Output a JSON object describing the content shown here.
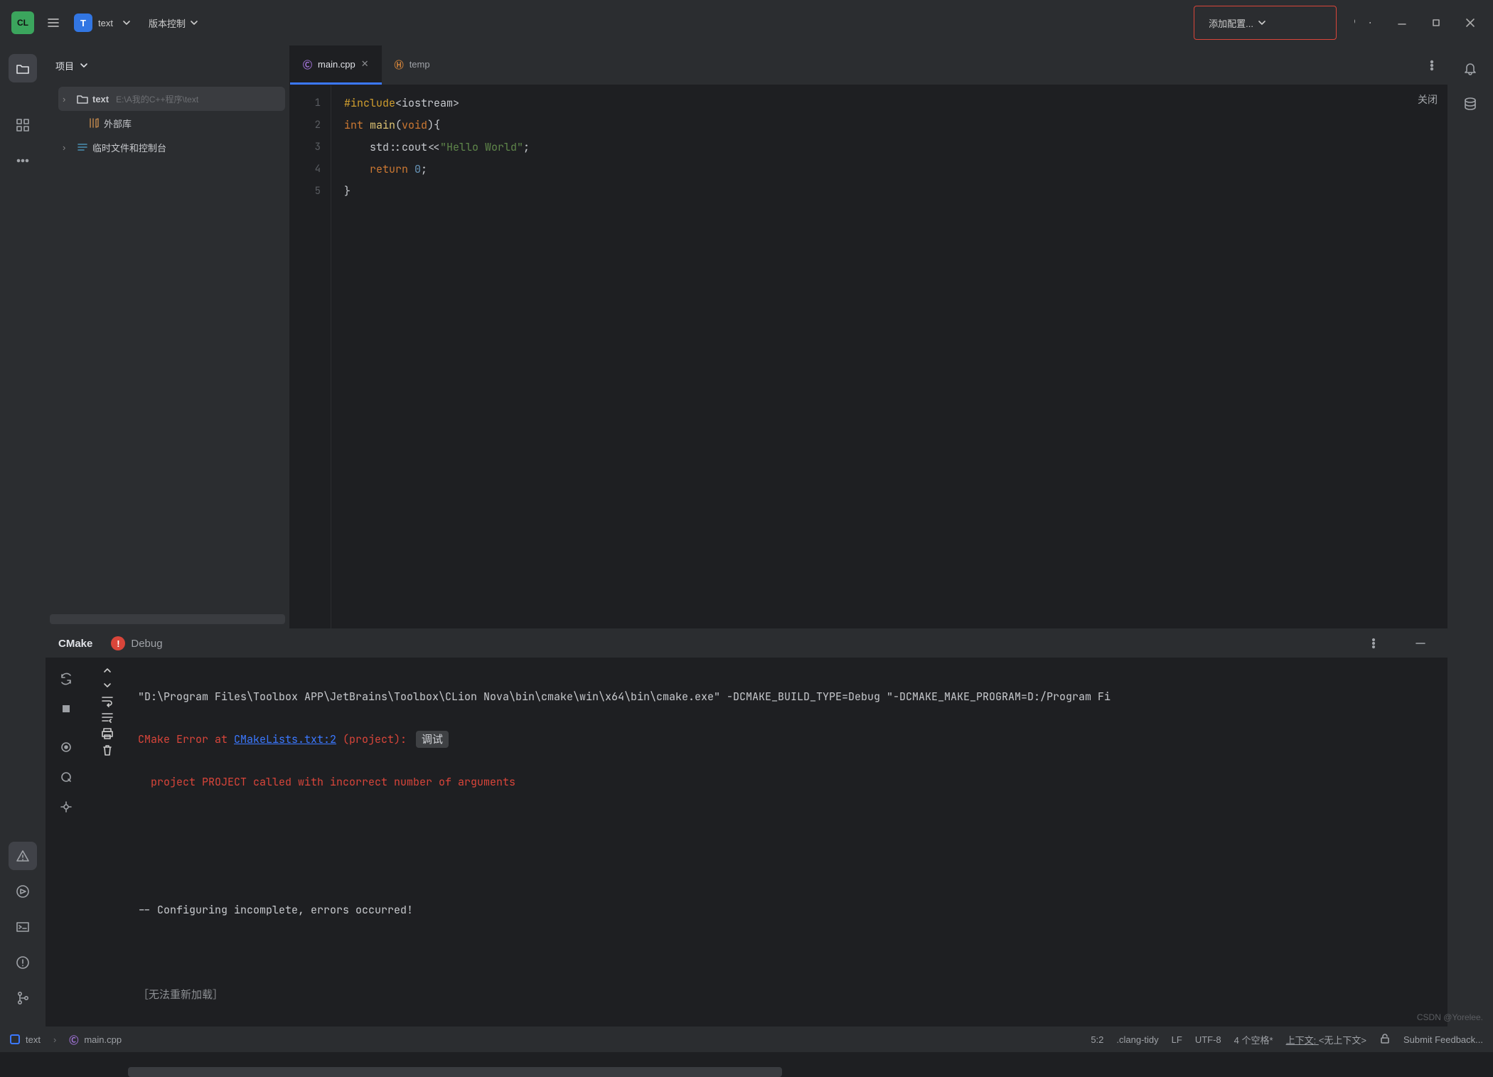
{
  "title": {
    "project": "text",
    "vcs": "版本控制"
  },
  "run": {
    "config": "添加配置..."
  },
  "proj_panel": {
    "title": "项目"
  },
  "tree": {
    "root": {
      "name": "text",
      "path": "E:\\A我的C++程序\\text"
    },
    "ext_lib": "外部库",
    "scratch": "临时文件和控制台"
  },
  "tabs": [
    {
      "icon": "cpp",
      "label": "main.cpp",
      "active": true
    },
    {
      "icon": "h",
      "label": "temp",
      "active": false
    }
  ],
  "editor": {
    "lines": [
      "1",
      "2",
      "3",
      "4",
      "5"
    ],
    "close_label": "关闭",
    "code": {
      "l1_dir": "#include",
      "l1_a1": "<",
      "l1_id": "iostream",
      "l1_a2": ">",
      "l2_kw": "int ",
      "l2_fn": "main",
      "l2_p1": "(",
      "l2_void": "void",
      "l2_p2": "){",
      "l3_pre": "    std::cout<<",
      "l3_str": "\"Hello World\"",
      "l3_end": ";",
      "l4_pre": "    ",
      "l4_ret": "return ",
      "l4_num": "0",
      "l4_end": ";",
      "l5": "}"
    }
  },
  "toolwin": {
    "tabs": {
      "cmake": "CMake",
      "debug": "Debug"
    },
    "console": {
      "cmd": "\"D:\\Program Files\\Toolbox APP\\JetBrains\\Toolbox\\CLion Nova\\bin\\cmake\\win\\x64\\bin\\cmake.exe\" -DCMAKE_BUILD_TYPE=Debug \"-DCMAKE_MAKE_PROGRAM=D:/Program Fi",
      "err_pre": "CMake Error at ",
      "err_link": "CMakeLists.txt:2",
      "err_post": " (project): ",
      "err_chip": "调试",
      "err_detail": "  project PROJECT called with incorrect number of arguments",
      "cfg": "-- Configuring incomplete, errors occurred!",
      "reload": "［无法重新加载］"
    }
  },
  "status": {
    "crumb_root": "text",
    "crumb_file": "main.cpp",
    "pos": "5:2",
    "tidy": ".clang-tidy",
    "lf": "LF",
    "enc": "UTF-8",
    "indent": "4 个空格*",
    "ctx_label": "上下文: ",
    "ctx_val": "<无上下文>",
    "feedback": "Submit Feedback...",
    "watermark": "CSDN @Yorelee."
  }
}
